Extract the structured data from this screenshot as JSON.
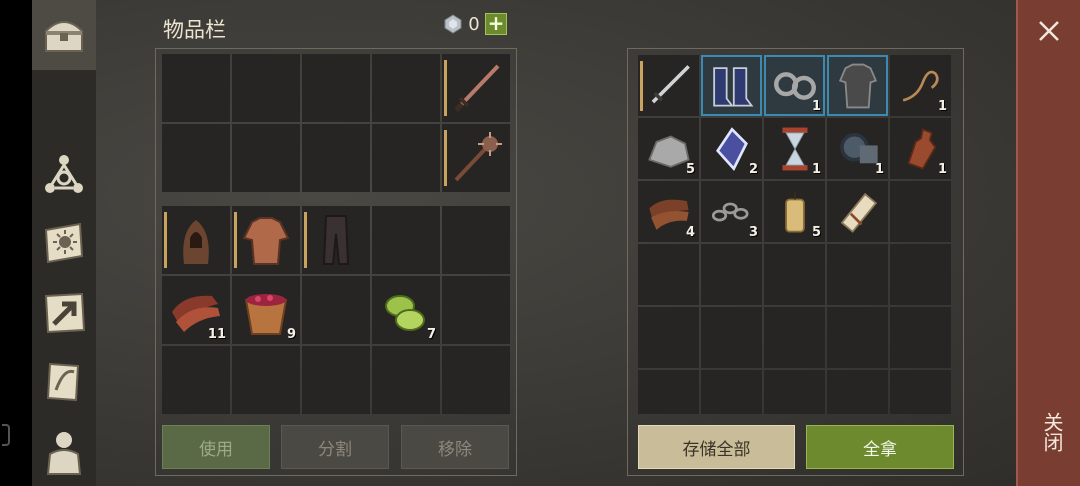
{
  "header": {
    "title": "物品栏",
    "currency_count": "0",
    "plus_label": "+"
  },
  "tabs": [
    {
      "icon": "chest-icon",
      "active": true
    },
    {
      "icon": "tech-tree-icon"
    },
    {
      "icon": "sun-book-icon"
    },
    {
      "icon": "map-arrow-icon"
    },
    {
      "icon": "quest-scroll-icon"
    },
    {
      "icon": "character-icon"
    }
  ],
  "left_equip_qty": [
    "",
    "",
    "",
    "",
    "",
    "",
    "",
    "",
    "",
    ""
  ],
  "left_bag": {
    "quantities": [
      "",
      "",
      "",
      "",
      "",
      "11",
      "9",
      "",
      "7",
      "",
      "",
      "",
      "",
      "",
      ""
    ]
  },
  "right_container": {
    "quantities": [
      "",
      "",
      "1",
      "",
      "1",
      "5",
      "2",
      "1",
      "1",
      "1",
      "4",
      "3",
      "5",
      "",
      "",
      "",
      "",
      "",
      "",
      "",
      "",
      "",
      "",
      "",
      "",
      "",
      "",
      "",
      "",
      ""
    ]
  },
  "buttons": {
    "use": "使用",
    "split": "分割",
    "remove": "移除",
    "store_all": "存储全部",
    "take_all": "全拿"
  },
  "close": {
    "label": "关闭"
  },
  "colors": {
    "accent_green": "#6d8a2f",
    "close_red": "#7a3d32",
    "highlight_blue": "#3b8ab4"
  }
}
